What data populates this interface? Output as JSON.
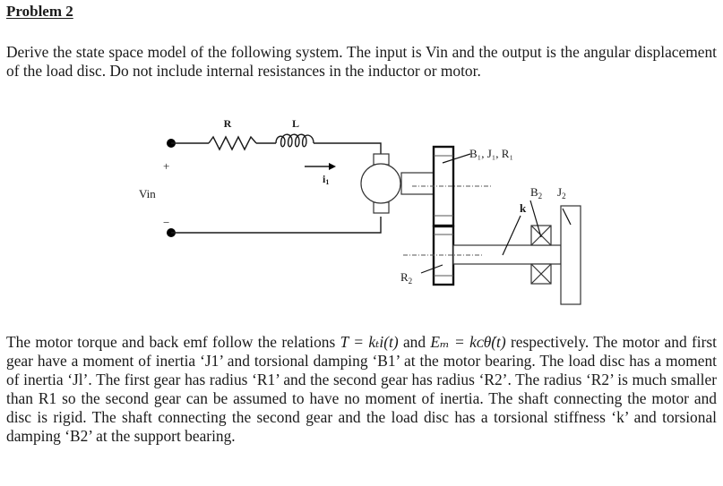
{
  "document": {
    "title": "Problem 2",
    "intro": "Derive the state space model of the following system. The input is Vin and the output is the angular displacement of the load disc. Do not include internal resistances in the inductor or motor.",
    "description": {
      "part1": "The motor torque and back emf follow the relations ",
      "eq1": "T = kₜi(t)",
      "part2": " and ",
      "eq2": "Eₘ = kᴄθ̇(t)",
      "part3": " respectively. The motor and first gear have a moment of inertia ‘J1’ and torsional damping ‘B1’ at the motor bearing. The load disc has a moment of inertia ‘Jl’. The first gear has radius ‘R1’ and the second gear has radius ‘R2’. The radius ‘R2’ is much smaller than R1 so the second gear can be assumed to have no moment of inertia. The shaft connecting the motor and disc is rigid. The shaft connecting the second gear and the load disc has a torsional stiffness ‘k’ and torsional damping ‘B2’ at the support bearing."
    }
  },
  "diagram": {
    "labels": {
      "resistor": "R",
      "inductor": "L",
      "current": "i",
      "current_sub": "1",
      "plus": "+",
      "minus": "−",
      "vin": "Vin",
      "gear1": "B₁, J₁, R₁",
      "gear2": "R",
      "gear2_sub": "2",
      "stiffness": "k",
      "bearing2": "B",
      "bearing2_sub": "2",
      "disc": "J",
      "disc_sub": "2"
    }
  }
}
